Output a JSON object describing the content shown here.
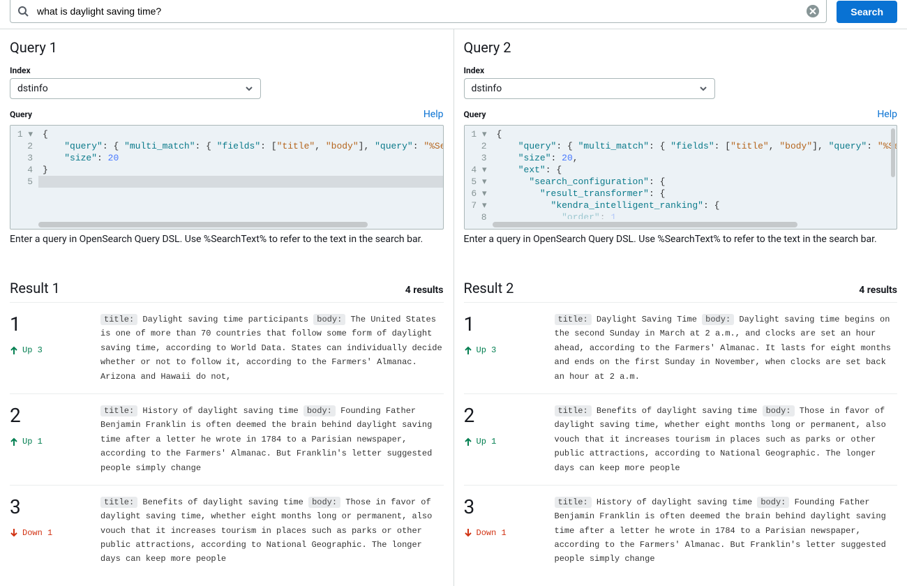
{
  "search": {
    "value": "what is daylight saving time?",
    "button": "Search"
  },
  "panels": [
    {
      "title": "Query 1",
      "indexLabel": "Index",
      "indexValue": "dstinfo",
      "queryLabel": "Query",
      "helpLabel": "Help",
      "hint": "Enter a query in OpenSearch Query DSL. Use %SearchText% to refer to the text in the search bar.",
      "hthumbWidth": "82%",
      "vscroll": false,
      "lines": [
        {
          "num": "1",
          "fold": true,
          "tokens": [
            "pun:{"
          ]
        },
        {
          "num": "2",
          "tokens": [
            "pad4",
            "key:\"query\"",
            "pun::",
            " ",
            "pun:{",
            " ",
            "key:\"multi_match\"",
            "pun::",
            " ",
            "pun:{",
            " ",
            "key:\"fields\"",
            "pun::",
            " ",
            "pun:[",
            "str:\"title\"",
            "pun:,",
            " ",
            "str:\"body\"",
            "pun:]",
            "pun:,",
            " ",
            "key:\"query\"",
            "pun::",
            " ",
            "str:\"%SearchT"
          ]
        },
        {
          "num": "3",
          "tokens": [
            "pad4",
            "key:\"size\"",
            "pun::",
            " ",
            "num:20"
          ]
        },
        {
          "num": "4",
          "tokens": [
            "pun:}"
          ]
        },
        {
          "num": "5",
          "highlight": true,
          "tokens": []
        }
      ]
    },
    {
      "title": "Query 2",
      "indexLabel": "Index",
      "indexValue": "dstinfo",
      "queryLabel": "Query",
      "helpLabel": "Help",
      "hint": "Enter a query in OpenSearch Query DSL. Use %SearchText% to refer to the text in the search bar.",
      "hthumbWidth": "76%",
      "vscroll": true,
      "lines": [
        {
          "num": "1",
          "fold": true,
          "tokens": [
            "pun:{"
          ]
        },
        {
          "num": "2",
          "tokens": [
            "pad4",
            "key:\"query\"",
            "pun::",
            " ",
            "pun:{",
            " ",
            "key:\"multi_match\"",
            "pun::",
            " ",
            "pun:{",
            " ",
            "key:\"fields\"",
            "pun::",
            " ",
            "pun:[",
            "str:\"title\"",
            "pun:,",
            " ",
            "str:\"body\"",
            "pun:]",
            "pun:,",
            " ",
            "key:\"query\"",
            "pun::",
            " ",
            "str:\"%Sear"
          ]
        },
        {
          "num": "3",
          "tokens": [
            "pad4",
            "key:\"size\"",
            "pun::",
            " ",
            "num:20",
            "pun:,"
          ]
        },
        {
          "num": "4",
          "fold": true,
          "tokens": [
            "pad4",
            "key:\"ext\"",
            "pun::",
            " ",
            "pun:{"
          ]
        },
        {
          "num": "5",
          "fold": true,
          "tokens": [
            "pad6",
            "key:\"search_configuration\"",
            "pun::",
            " ",
            "pun:{"
          ]
        },
        {
          "num": "6",
          "fold": true,
          "tokens": [
            "pad8",
            "key:\"result_transformer\"",
            "pun::",
            " ",
            "pun:{"
          ]
        },
        {
          "num": "7",
          "fold": true,
          "tokens": [
            "pad10",
            "key:\"kendra_intelligent_ranking\"",
            "pun::",
            " ",
            "pun:{"
          ]
        },
        {
          "num": "8",
          "tokens": [
            "pad12",
            "key-faded:\"order\"",
            "pun-faded::",
            " ",
            "num-faded:1"
          ]
        }
      ]
    }
  ],
  "results": [
    {
      "title": "Result 1",
      "count": "4 results",
      "items": [
        {
          "rank": "1",
          "dir": "up",
          "move": "Up 3",
          "tlabel": "title:",
          "blabel": "body:",
          "titleText": "Daylight saving time participants",
          "body": "The United States is one of more than 70 countries that follow some form of daylight saving time, according to World Data. States can individually decide whether or not to follow it, according to the Farmers' Almanac. Arizona and Hawaii do not,"
        },
        {
          "rank": "2",
          "dir": "up",
          "move": "Up 1",
          "tlabel": "title:",
          "blabel": "body:",
          "titleText": "History of daylight saving time",
          "body": "Founding Father Benjamin Franklin is often deemed the brain behind daylight saving time after a letter he wrote in 1784 to a Parisian newspaper, according to the Farmers' Almanac. But Franklin's letter suggested people simply change"
        },
        {
          "rank": "3",
          "dir": "down",
          "move": "Down 1",
          "tlabel": "title:",
          "blabel": "body:",
          "titleText": "Benefits of daylight saving time",
          "body": "Those in favor of daylight saving time, whether eight months long or permanent, also vouch that it increases tourism in places such as parks or other public attractions, according to National Geographic. The longer days can keep more people"
        }
      ]
    },
    {
      "title": "Result 2",
      "count": "4 results",
      "items": [
        {
          "rank": "1",
          "dir": "up",
          "move": "Up 3",
          "tlabel": "title:",
          "blabel": "body:",
          "titleText": "Daylight Saving Time",
          "body": "Daylight saving time begins on the second Sunday in March at 2 a.m., and clocks are set an hour ahead, according to the Farmers' Almanac. It lasts for eight months and ends on the first Sunday in November, when clocks are set back an hour at 2 a.m."
        },
        {
          "rank": "2",
          "dir": "up",
          "move": "Up 1",
          "tlabel": "title:",
          "blabel": "body:",
          "titleText": "Benefits of daylight saving time",
          "body": "Those in favor of daylight saving time, whether eight months long or permanent, also vouch that it increases tourism in places such as parks or other public attractions, according to National Geographic. The longer days can keep more people"
        },
        {
          "rank": "3",
          "dir": "down",
          "move": "Down 1",
          "tlabel": "title:",
          "blabel": "body:",
          "titleText": "History of daylight saving time",
          "body": "Founding Father Benjamin Franklin is often deemed the brain behind daylight saving time after a letter he wrote in 1784 to a Parisian newspaper, according to the Farmers' Almanac. But Franklin's letter suggested people simply change"
        }
      ]
    }
  ]
}
